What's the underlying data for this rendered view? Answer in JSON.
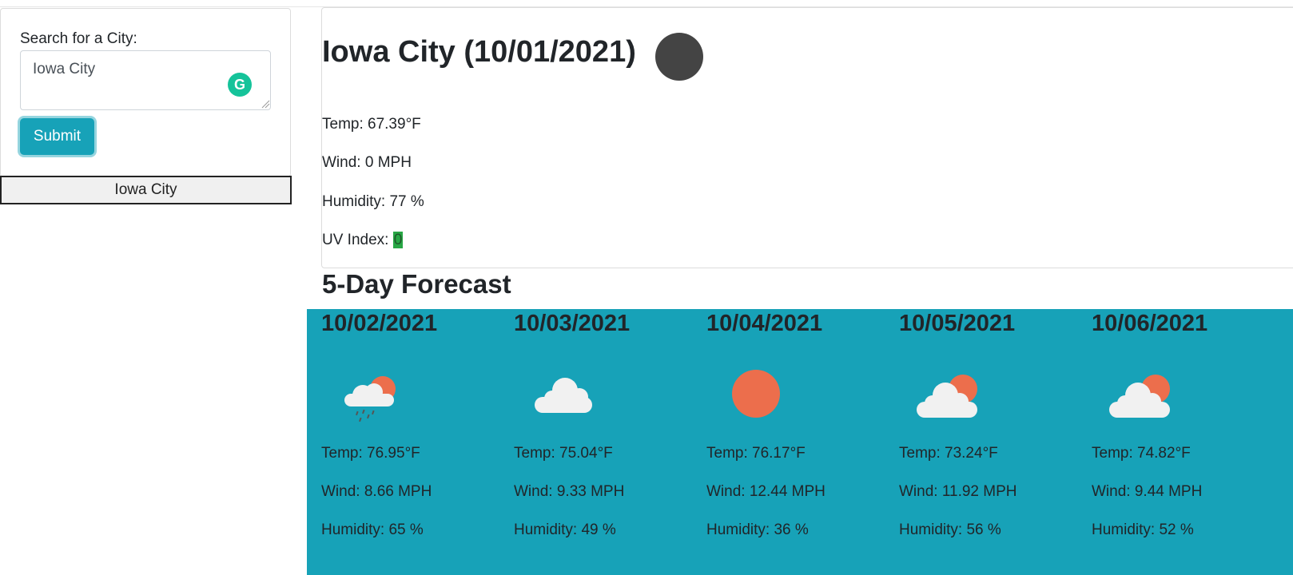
{
  "sidebar": {
    "search_label": "Search for a City:",
    "input_value": "Iowa City",
    "submit_label": "Submit",
    "history": [
      "Iowa City"
    ]
  },
  "current": {
    "title": "Iowa City (10/01/2021)",
    "temp": "Temp: 67.39°F",
    "wind": "Wind: 0 MPH",
    "humidity": "Humidity: 77 %",
    "uv_label": "UV Index: ",
    "uv_value": "0",
    "icon": "night-clear-icon"
  },
  "forecast": {
    "title": "5-Day Forecast",
    "days": [
      {
        "date": "10/02/2021",
        "icon": "rain-cloud-sun-icon",
        "temp": "Temp: 76.95°F",
        "wind": "Wind: 8.66 MPH",
        "humidity": "Humidity: 65 %"
      },
      {
        "date": "10/03/2021",
        "icon": "cloud-icon",
        "temp": "Temp: 75.04°F",
        "wind": "Wind: 9.33 MPH",
        "humidity": "Humidity: 49 %"
      },
      {
        "date": "10/04/2021",
        "icon": "sun-icon",
        "temp": "Temp: 76.17°F",
        "wind": "Wind: 12.44 MPH",
        "humidity": "Humidity: 36 %"
      },
      {
        "date": "10/05/2021",
        "icon": "cloud-sun-icon",
        "temp": "Temp: 73.24°F",
        "wind": "Wind: 11.92 MPH",
        "humidity": "Humidity: 56 %"
      },
      {
        "date": "10/06/2021",
        "icon": "cloud-sun-icon",
        "temp": "Temp: 74.82°F",
        "wind": "Wind: 9.44 MPH",
        "humidity": "Humidity: 52 %"
      }
    ]
  },
  "colors": {
    "accent": "#17a2b8",
    "uv_low": "#28a745",
    "sun": "#ec6e4c",
    "cloud": "#f1f1f1",
    "night_icon": "#444444"
  }
}
